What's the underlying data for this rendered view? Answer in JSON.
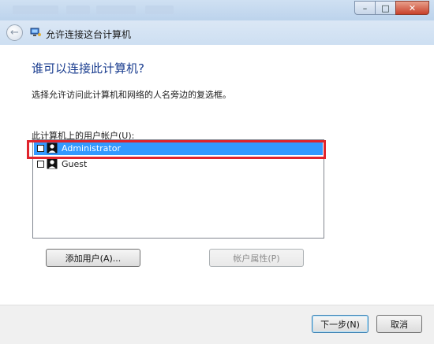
{
  "window": {
    "title": "允许连接这台计算机",
    "controls": {
      "minimize": "–",
      "maximize": "□",
      "close": "✕"
    }
  },
  "navigation": {
    "back_icon": "back-arrow-icon"
  },
  "page": {
    "heading": "谁可以连接此计算机?",
    "description": "选择允许访问此计算机和网络的人名旁边的复选框。",
    "list_label": "此计算机上的用户帐户(U):"
  },
  "users": [
    {
      "name": "Administrator",
      "checked": false,
      "selected": true
    },
    {
      "name": "Guest",
      "checked": false,
      "selected": false
    }
  ],
  "buttons": {
    "add_user": "添加用户(A)...",
    "account_properties": "帐户属性(P)",
    "next": "下一步(N)",
    "cancel": "取消"
  },
  "colors": {
    "heading": "#1a3d8f",
    "selection": "#3399ff",
    "annotation_box": "#e0242c"
  }
}
